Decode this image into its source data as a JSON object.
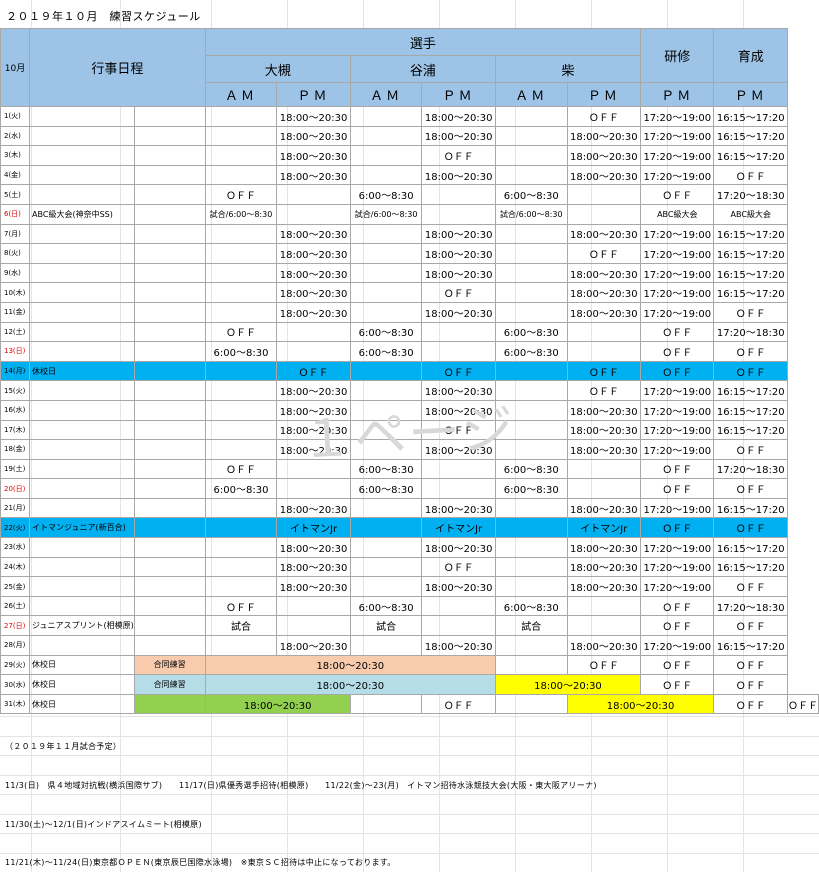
{
  "title": "２０１９年１０月　練習スケジュール",
  "header": {
    "month_label": "10月",
    "event_col": "行事日程",
    "senshu": "選手",
    "kenshu": "研修",
    "ikusei": "育成",
    "coaches": [
      "大槻",
      "谷浦",
      "柴"
    ],
    "am": "ＡＭ",
    "pm": "ＰＭ"
  },
  "rows": [
    {
      "day": "1(火)",
      "ev": "",
      "sub": "",
      "c": [
        "",
        "18:00～20:30",
        "",
        "18:00～20:30",
        "",
        "ＯＦＦ",
        "17:20～19:00",
        "16:15～17:20"
      ]
    },
    {
      "day": "2(水)",
      "ev": "",
      "sub": "",
      "c": [
        "",
        "18:00～20:30",
        "",
        "18:00～20:30",
        "",
        "18:00～20:30",
        "17:20～19:00",
        "16:15～17:20"
      ]
    },
    {
      "day": "3(木)",
      "ev": "",
      "sub": "",
      "c": [
        "",
        "18:00～20:30",
        "",
        "ＯＦＦ",
        "",
        "18:00～20:30",
        "17:20～19:00",
        "16:15～17:20"
      ]
    },
    {
      "day": "4(金)",
      "ev": "",
      "sub": "",
      "c": [
        "",
        "18:00～20:30",
        "",
        "18:00～20:30",
        "",
        "18:00～20:30",
        "17:20～19:00",
        "ＯＦＦ"
      ]
    },
    {
      "day": "5(土)",
      "ev": "",
      "sub": "",
      "c": [
        "ＯＦＦ",
        "",
        "6:00～8:30",
        "",
        "6:00～8:30",
        "",
        "ＯＦＦ",
        "17:20～18:30"
      ]
    },
    {
      "day": "6(日)",
      "ev": "ABC級大会(神奈中SS)",
      "sub": "",
      "c": [
        "試合/6:00～8:30",
        "",
        "試合/6:00～8:30",
        "",
        "試合/6:00～8:30",
        "",
        "ABC級大会",
        "ABC級大会"
      ]
    },
    {
      "day": "7(月)",
      "ev": "",
      "sub": "",
      "c": [
        "",
        "18:00～20:30",
        "",
        "18:00～20:30",
        "",
        "18:00～20:30",
        "17:20～19:00",
        "16:15～17:20"
      ]
    },
    {
      "day": "8(火)",
      "ev": "",
      "sub": "",
      "c": [
        "",
        "18:00～20:30",
        "",
        "18:00～20:30",
        "",
        "ＯＦＦ",
        "17:20～19:00",
        "16:15～17:20"
      ]
    },
    {
      "day": "9(水)",
      "ev": "",
      "sub": "",
      "c": [
        "",
        "18:00～20:30",
        "",
        "18:00～20:30",
        "",
        "18:00～20:30",
        "17:20～19:00",
        "16:15～17:20"
      ]
    },
    {
      "day": "10(木)",
      "ev": "",
      "sub": "",
      "c": [
        "",
        "18:00～20:30",
        "",
        "ＯＦＦ",
        "",
        "18:00～20:30",
        "17:20～19:00",
        "16:15～17:20"
      ]
    },
    {
      "day": "11(金)",
      "ev": "",
      "sub": "",
      "c": [
        "",
        "18:00～20:30",
        "",
        "18:00～20:30",
        "",
        "18:00～20:30",
        "17:20～19:00",
        "ＯＦＦ"
      ]
    },
    {
      "day": "12(土)",
      "ev": "",
      "sub": "",
      "c": [
        "ＯＦＦ",
        "",
        "6:00～8:30",
        "",
        "6:00～8:30",
        "",
        "ＯＦＦ",
        "17:20～18:30"
      ]
    },
    {
      "day": "13(日)",
      "ev": "",
      "sub": "",
      "c": [
        "6:00～8:30",
        "",
        "6:00～8:30",
        "",
        "6:00～8:30",
        "",
        "ＯＦＦ",
        "ＯＦＦ"
      ]
    },
    {
      "day": "14(月)",
      "ev": "休校日",
      "sub": "",
      "c": [
        "",
        "ＯＦＦ",
        "",
        "ＯＦＦ",
        "",
        "ＯＦＦ",
        "ＯＦＦ",
        "ＯＦＦ"
      ]
    },
    {
      "day": "15(火)",
      "ev": "",
      "sub": "",
      "c": [
        "",
        "18:00～20:30",
        "",
        "18:00～20:30",
        "",
        "ＯＦＦ",
        "17:20～19:00",
        "16:15～17:20"
      ]
    },
    {
      "day": "16(水)",
      "ev": "",
      "sub": "",
      "c": [
        "",
        "18:00～20:30",
        "",
        "18:00～20:30",
        "",
        "18:00～20:30",
        "17:20～19:00",
        "16:15～17:20"
      ]
    },
    {
      "day": "17(木)",
      "ev": "",
      "sub": "",
      "c": [
        "",
        "18:00～20:30",
        "",
        "ＯＦＦ",
        "",
        "18:00～20:30",
        "17:20～19:00",
        "16:15～17:20"
      ]
    },
    {
      "day": "18(金)",
      "ev": "",
      "sub": "",
      "c": [
        "",
        "18:00～20:30",
        "",
        "18:00～20:30",
        "",
        "18:00～20:30",
        "17:20～19:00",
        "ＯＦＦ"
      ]
    },
    {
      "day": "19(土)",
      "ev": "",
      "sub": "",
      "c": [
        "ＯＦＦ",
        "",
        "6:00～8:30",
        "",
        "6:00～8:30",
        "",
        "ＯＦＦ",
        "17:20～18:30"
      ]
    },
    {
      "day": "20(日)",
      "ev": "",
      "sub": "",
      "c": [
        "6:00～8:30",
        "",
        "6:00～8:30",
        "",
        "6:00～8:30",
        "",
        "ＯＦＦ",
        "ＯＦＦ"
      ]
    },
    {
      "day": "21(月)",
      "ev": "",
      "sub": "",
      "c": [
        "",
        "18:00～20:30",
        "",
        "18:00～20:30",
        "",
        "18:00～20:30",
        "17:20～19:00",
        "16:15～17:20"
      ]
    },
    {
      "day": "22(火)",
      "ev": "イトマンジュニア(新百合)",
      "sub": "",
      "c": [
        "",
        "イトマンJr",
        "",
        "イトマンJr",
        "",
        "イトマンJr",
        "ＯＦＦ",
        "ＯＦＦ"
      ]
    },
    {
      "day": "23(水)",
      "ev": "",
      "sub": "",
      "c": [
        "",
        "18:00～20:30",
        "",
        "18:00～20:30",
        "",
        "18:00～20:30",
        "17:20～19:00",
        "16:15～17:20"
      ]
    },
    {
      "day": "24(木)",
      "ev": "",
      "sub": "",
      "c": [
        "",
        "18:00～20:30",
        "",
        "ＯＦＦ",
        "",
        "18:00～20:30",
        "17:20～19:00",
        "16:15～17:20"
      ]
    },
    {
      "day": "25(金)",
      "ev": "",
      "sub": "",
      "c": [
        "",
        "18:00～20:30",
        "",
        "18:00～20:30",
        "",
        "18:00～20:30",
        "17:20～19:00",
        "ＯＦＦ"
      ]
    },
    {
      "day": "26(土)",
      "ev": "",
      "sub": "",
      "c": [
        "ＯＦＦ",
        "",
        "6:00～8:30",
        "",
        "6:00～8:30",
        "",
        "ＯＦＦ",
        "17:20～18:30"
      ]
    },
    {
      "day": "27(日)",
      "ev": "ジュニアスプリント(相模原)",
      "sub": "",
      "c": [
        "試合",
        "",
        "試合",
        "",
        "試合",
        "",
        "ＯＦＦ",
        "ＯＦＦ"
      ]
    },
    {
      "day": "28(月)",
      "ev": "",
      "sub": "",
      "c": [
        "",
        "18:00～20:30",
        "",
        "18:00～20:30",
        "",
        "18:00～20:30",
        "17:20～19:00",
        "16:15～17:20"
      ]
    }
  ],
  "special": {
    "r29": {
      "day": "29(火)",
      "ev": "休校日",
      "sub": "合同練習",
      "merged": "18:00～20:30",
      "c": [
        "",
        "ＯＦＦ",
        "ＯＦＦ",
        "ＯＦＦ"
      ]
    },
    "r30": {
      "day": "30(水)",
      "ev": "休校日",
      "sub": "合同練習",
      "merged": "18:00～20:30",
      "c": [
        "18:00～20:30",
        "ＯＦＦ",
        "ＯＦＦ"
      ]
    },
    "r31": {
      "day": "31(木)",
      "ev": "休校日",
      "sub": "",
      "c": [
        "18:00～20:30",
        "",
        "ＯＦＦ",
        "",
        "18:00～20:30",
        "ＯＦＦ",
        "ＯＦＦ"
      ]
    }
  },
  "notes": {
    "n1": "（２０１９年１１月試合予定）",
    "n2": "11/3(日)　県４地域対抗戦(横浜国際サブ)　　11/17(日)県優秀選手招待(相模原)　　11/22(金)～23(月)　イトマン招待水泳競技大会(大阪・東大阪アリーナ)",
    "n3": "11/30(土)～12/1(日)インドアスイムミート(相模原)",
    "n4": "11/21(木)～11/24(日)東京都ＯＰＥＮ(東京辰巳国際水泳場)　※東京ＳＣ招待は中止になっております。"
  },
  "watermark": "１ページ",
  "colors": {
    "header_blue": "#9dc3e6",
    "holiday_blue": "#00b0f0",
    "peach": "#f8cbad",
    "light_blue": "#b4dde8",
    "green": "#92d050",
    "yellow": "#ffff00",
    "sunday_red": "#e00000"
  }
}
